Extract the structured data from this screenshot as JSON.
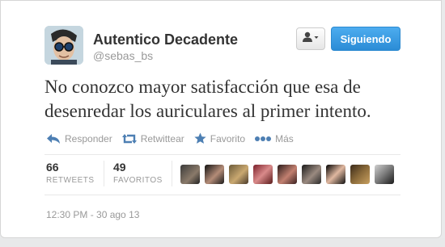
{
  "tweet": {
    "author_name": "Autentico Decadente",
    "author_handle": "@sebas_bs",
    "text_line1": "No conozco mayor satisfacción que esa de",
    "text_line2": "desenredar los auriculares al primer intento.",
    "timestamp": "12:30 PM - 30 ago 13"
  },
  "buttons": {
    "user_menu_icon": "person-dropdown-icon",
    "follow_label": "Siguiendo"
  },
  "actions": [
    {
      "label": "Responder",
      "icon": "reply-icon"
    },
    {
      "label": "Retwittear",
      "icon": "retweet-icon"
    },
    {
      "label": "Favorito",
      "icon": "star-icon"
    },
    {
      "label": "Más",
      "icon": "more-dots-icon"
    }
  ],
  "stats": {
    "retweets_count": "66",
    "retweets_label": "RETWEETS",
    "favorites_count": "49",
    "favorites_label": "FAVORITOS"
  },
  "colors": {
    "follow_button": "#2b8cd6",
    "action_icon": "#4d7fb3",
    "text_muted": "#999999"
  }
}
